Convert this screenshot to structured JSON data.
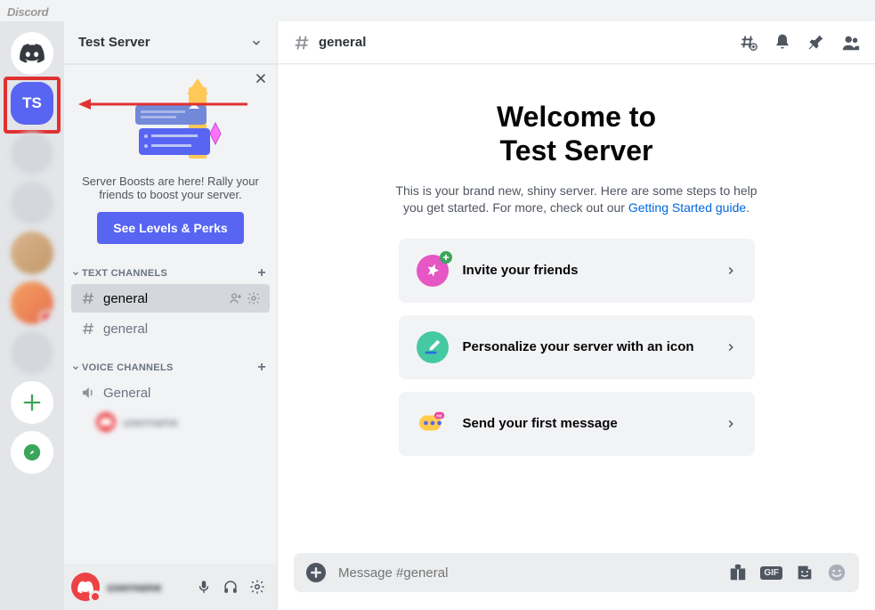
{
  "app_name": "Discord",
  "servers": {
    "ts_label": "TS"
  },
  "sidebar": {
    "server_name": "Test Server",
    "boost": {
      "text": "Server Boosts are here! Rally your friends to boost your server.",
      "button": "See Levels & Perks"
    },
    "cat_text": "TEXT CHANNELS",
    "cat_voice": "VOICE CHANNELS",
    "text_channels": {
      "0": {
        "name": "general"
      },
      "1": {
        "name": "general"
      }
    },
    "voice_channels": {
      "0": {
        "name": "General"
      }
    }
  },
  "header": {
    "channel": "general"
  },
  "welcome": {
    "line1": "Welcome to",
    "line2": "Test Server",
    "body_a": "This is your brand new, shiny server. Here are some steps to help you get started. For more, check out our ",
    "link": "Getting Started guide",
    "body_b": "."
  },
  "actions": {
    "0": "Invite your friends",
    "1": "Personalize your server with an icon",
    "2": "Send your first message"
  },
  "compose": {
    "placeholder": "Message #general",
    "gif_label": "GIF"
  }
}
